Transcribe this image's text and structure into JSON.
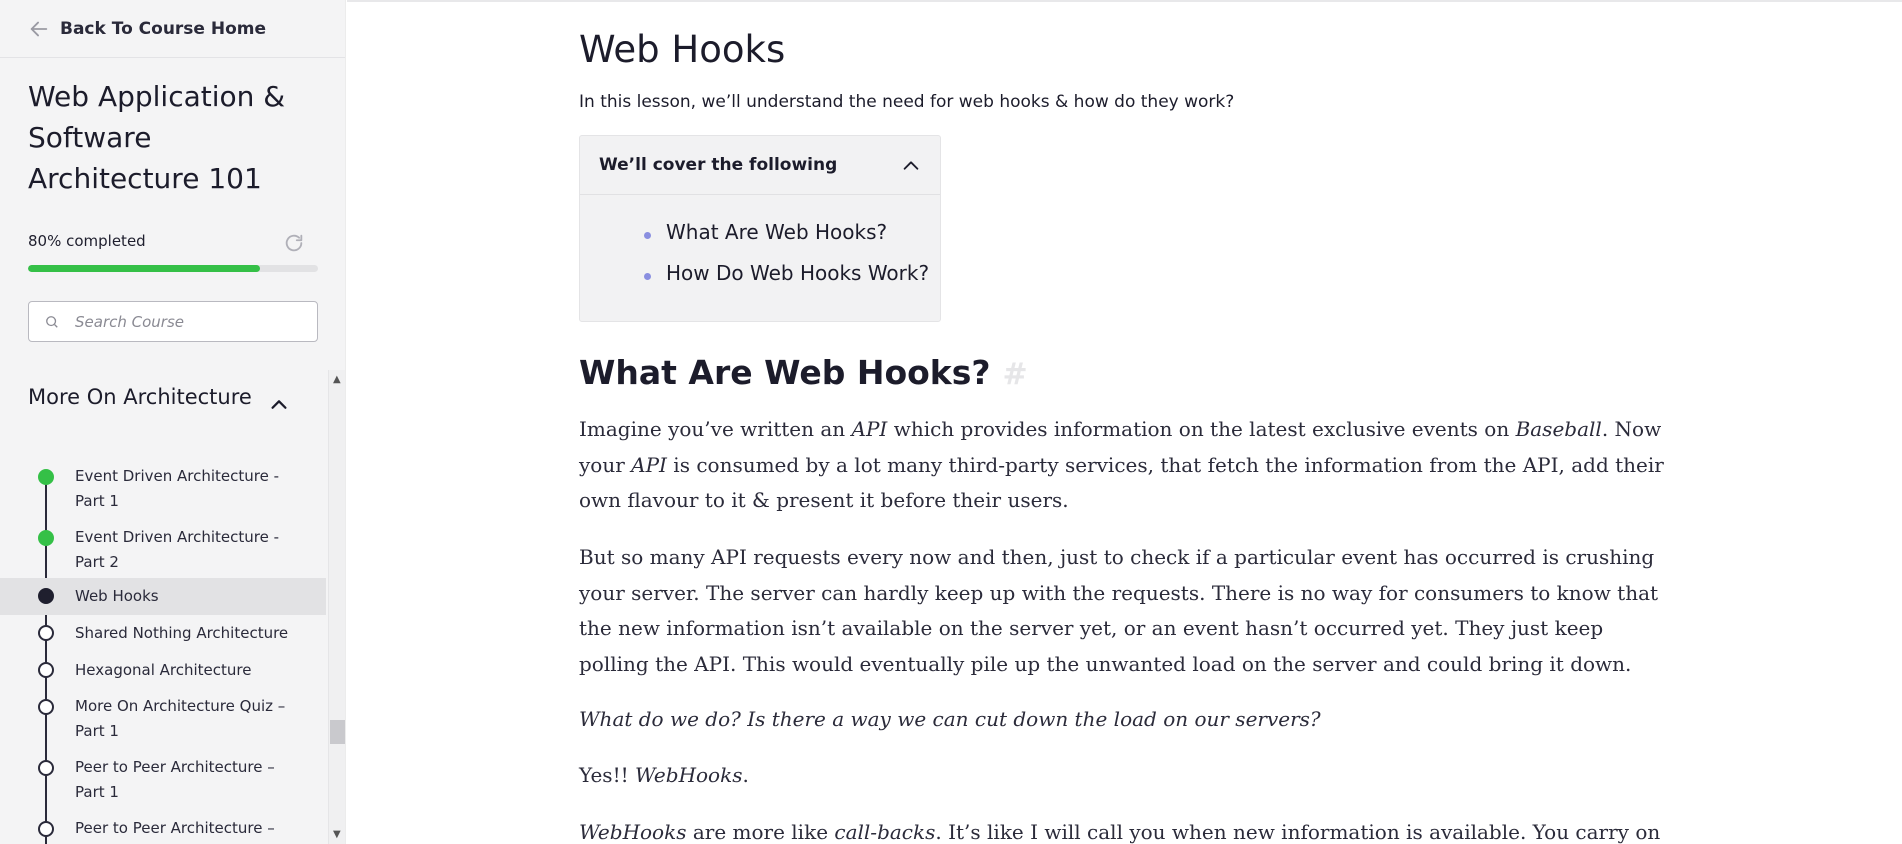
{
  "sidebar": {
    "back_label": "Back To Course Home",
    "course_title": "Web Application & Software Architecture 101",
    "progress": {
      "label": "80% completed",
      "percent": 80
    },
    "search": {
      "placeholder": "Search Course",
      "value": ""
    },
    "section": {
      "title": "More On Architecture",
      "lessons": [
        {
          "label": "Event Driven Architecture - Part 1",
          "status": "done"
        },
        {
          "label": "Event Driven Architecture - Part 2",
          "status": "done"
        },
        {
          "label": "Web Hooks",
          "status": "current"
        },
        {
          "label": "Shared Nothing Architecture",
          "status": "todo"
        },
        {
          "label": "Hexagonal Architecture",
          "status": "todo"
        },
        {
          "label": "More On Architecture Quiz – Part 1",
          "status": "todo"
        },
        {
          "label": "Peer to Peer Architecture – Part 1",
          "status": "todo"
        },
        {
          "label": "Peer to Peer Architecture –",
          "status": "todo"
        }
      ]
    }
  },
  "main": {
    "title": "Web Hooks",
    "subtitle": "In this lesson, we’ll understand the need for web hooks & how do they work?",
    "toc": {
      "title": "We’ll cover the following",
      "items": [
        "What Are Web Hooks?",
        "How Do Web Hooks Work?"
      ]
    },
    "section_heading": "What Are Web Hooks?",
    "anchor_symbol": "#",
    "paragraphs": {
      "p1": {
        "a": "Imagine you’ve written an ",
        "b": "API",
        "c": " which provides information on the latest exclusive events on ",
        "d": "Baseball",
        "e": ". Now your ",
        "f": "API",
        "g": " is consumed by a lot many third-party services, that fetch the information from the API, add their own flavour to it & present it before their users."
      },
      "p2": "But so many API requests every now and then, just to check if a particular event has occurred is crushing your server. The server can hardly keep up with the requests. There is no way for consumers to know that the new information isn’t available on the server yet, or an event hasn’t occurred yet. They just keep polling the API. This would eventually pile up the unwanted load on the server and could bring it down.",
      "p3": "What do we do? Is there a way we can cut down the load on our servers?",
      "p4": {
        "a": "Yes!! ",
        "b": "WebHooks",
        "c": "."
      },
      "p5": {
        "a": "WebHooks",
        "b": " are more like ",
        "c": "call-backs",
        "d": ". It’s like I will call you when new information is available. You carry on"
      }
    }
  },
  "colors": {
    "progress_fill": "#35c047",
    "lesson_done": "#35c047",
    "lesson_current": "#1f1f2e",
    "toc_bullet": "#8a8fe0"
  }
}
